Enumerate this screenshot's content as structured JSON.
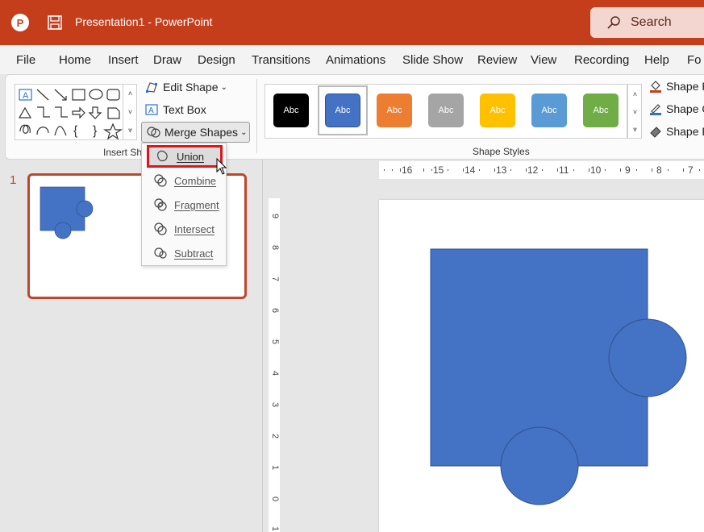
{
  "titlebar": {
    "logo_letter": "P",
    "title": "Presentation1  -  PowerPoint",
    "search_label": "Search",
    "colors": {
      "accent": "#c43e1c"
    }
  },
  "menu": {
    "items": [
      "File",
      "Home",
      "Insert",
      "Draw",
      "Design",
      "Transitions",
      "Animations",
      "Slide Show",
      "Review",
      "View",
      "Recording",
      "Help",
      "Fo"
    ]
  },
  "ribbon": {
    "insert_shapes_label": "Insert Sha",
    "edit_shape_label": "Edit Shape",
    "text_box_label": "Text Box",
    "merge_shapes_label": "Merge Shapes",
    "shape_styles_label": "Shape Styles",
    "style_swatches": [
      {
        "label": "Abc",
        "color": "#000000"
      },
      {
        "label": "Abc",
        "color": "#4472c4"
      },
      {
        "label": "Abc",
        "color": "#ed7d31"
      },
      {
        "label": "Abc",
        "color": "#a5a5a5"
      },
      {
        "label": "Abc",
        "color": "#ffc000"
      },
      {
        "label": "Abc",
        "color": "#5b9bd5"
      },
      {
        "label": "Abc",
        "color": "#70ad47"
      }
    ],
    "shape_fill_label": "Shape F",
    "shape_outline_label": "Shape O",
    "shape_effects_label": "Shape E"
  },
  "merge_menu": {
    "items": [
      "Union",
      "Combine",
      "Fragment",
      "Intersect",
      "Subtract"
    ],
    "highlighted": "Union"
  },
  "slides": {
    "number": "1"
  },
  "ruler": {
    "horizontal": [
      "16",
      "15",
      "14",
      "13",
      "12",
      "11",
      "10",
      "9",
      "8",
      "7"
    ],
    "vertical": [
      "9",
      "8",
      "7",
      "6",
      "5",
      "4",
      "3",
      "2",
      "1",
      "0",
      "1"
    ]
  },
  "slide_shapes": {
    "fill_color": "#4472c4",
    "outline_color": "#2f528f"
  }
}
